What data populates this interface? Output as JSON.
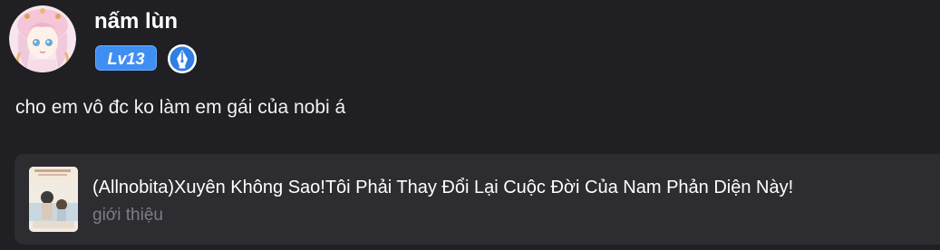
{
  "user": {
    "name": "nấm lùn",
    "level": "Lv13",
    "level_color": "#3f8ef2",
    "badge_icon": "fountain-pen-writer-icon"
  },
  "comment": {
    "text": "cho em vô đc ko làm em gái của nobi á"
  },
  "book": {
    "title": "(Allnobita)Xuyên Không Sao!Tôi Phải Thay Đổi Lại Cuộc Đời Của Nam Phản Diện Này!",
    "subtitle": "giới thiệu"
  },
  "colors": {
    "background": "#1f1f24",
    "card": "#2c2c31",
    "muted_text": "#7d7d84"
  }
}
